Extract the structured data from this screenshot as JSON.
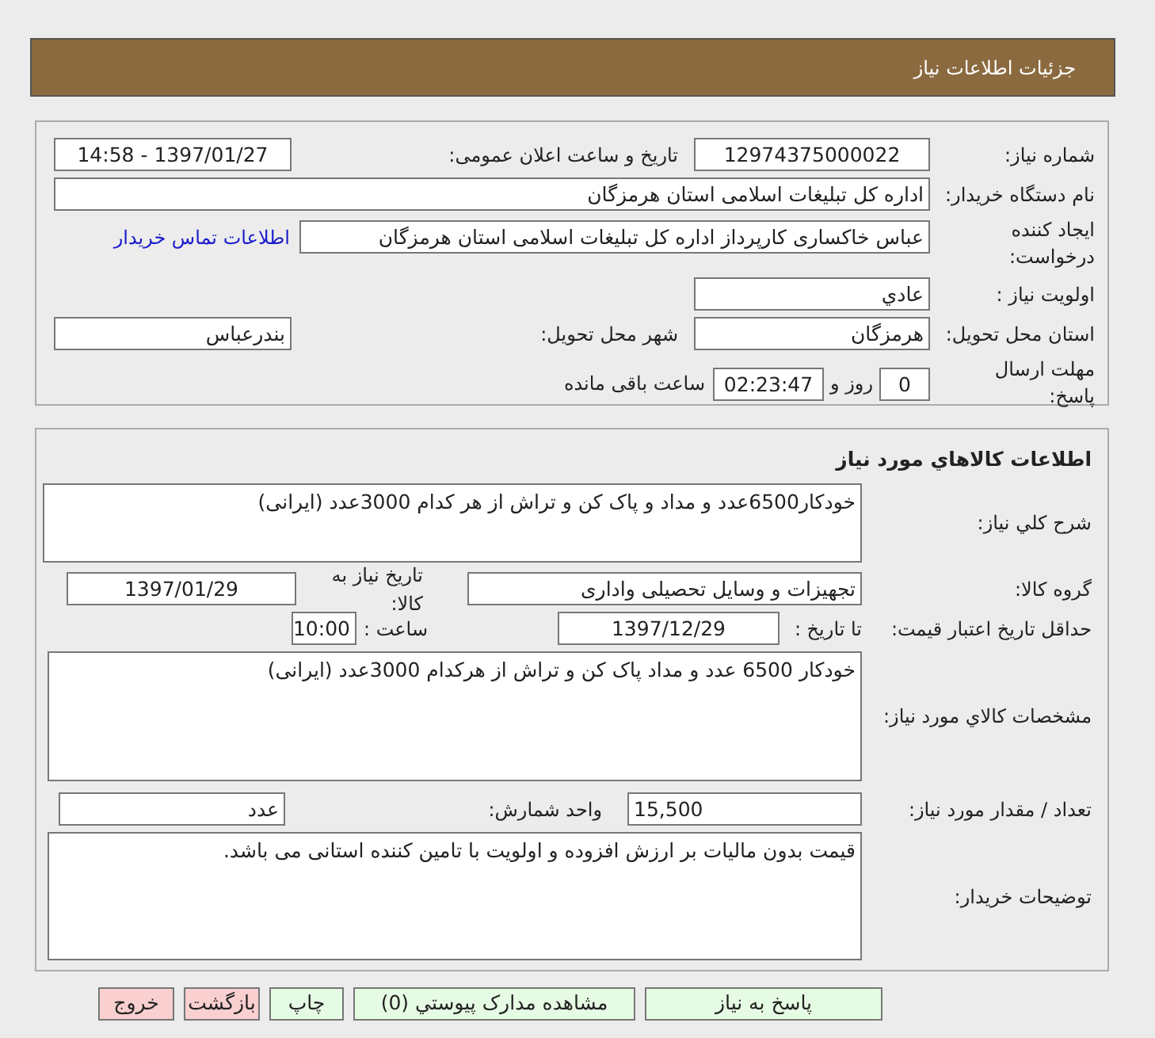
{
  "header": {
    "title": "جزئیات اطلاعات نیاز"
  },
  "need_info": {
    "need_number": {
      "label": "شماره نیاز:",
      "value": "12974375000022"
    },
    "announce_datetime": {
      "label": "تاریخ و ساعت اعلان عمومی:",
      "value": "1397/01/27 - 14:58"
    },
    "buyer_org": {
      "label": "نام دستگاه خریدار:",
      "value": "اداره کل تبلیغات اسلامی استان هرمزگان"
    },
    "requester": {
      "label": "ایجاد کننده درخواست:",
      "value": "عباس  خاکساری  کارپرداز اداره کل تبلیغات اسلامی استان هرمزگان"
    },
    "contact_link": "اطلاعات تماس خریدار",
    "priority": {
      "label": "اولویت نیاز :",
      "value": "عادي"
    },
    "delivery_province": {
      "label": "استان محل تحویل:",
      "value": "هرمزگان"
    },
    "delivery_city": {
      "label": "شهر محل تحویل:",
      "value": "بندرعباس"
    },
    "deadline": {
      "label": "مهلت ارسال پاسخ:",
      "days": "0",
      "days_unit": "روز و",
      "time": "02:23:47",
      "suffix": "ساعت باقی مانده"
    }
  },
  "goods": {
    "title": "اطلاعات کالاهاي مورد نياز",
    "general_description": {
      "label": "شرح کلي نياز:",
      "value": "خودکار6500عدد و مداد و پاک کن و تراش از هر کدام 3000عدد (ایرانی)"
    },
    "goods_group": {
      "label": "گروه کالا:",
      "value": "تجهیزات و وسایل تحصیلی واداری"
    },
    "need_date": {
      "label": "تاریخ نیاز به کالا:",
      "value": "1397/01/29"
    },
    "price_validity": {
      "label": "حداقل تاریخ اعتبار قیمت:",
      "date_label": "تا تاریخ :",
      "date": "1397/12/29",
      "time_label": "ساعت :",
      "time": "10:00"
    },
    "specifications": {
      "label": "مشخصات کالاي مورد نياز:",
      "value": "خودکار 6500 عدد و مداد پاک کن و تراش  از هرکدام 3000عدد (ایرانی)"
    },
    "quantity": {
      "label": "تعداد / مقدار مورد نیاز:",
      "value": "15,500"
    },
    "unit": {
      "label": "واحد شمارش:",
      "value": "عدد"
    },
    "buyer_notes": {
      "label": "توضیحات خریدار:",
      "value": "قیمت بدون مالیات بر ارزش افزوده و اولویت با تامین کننده استانی می باشد."
    }
  },
  "buttons": [
    {
      "label": "پاسخ به نیاز",
      "kind": "action"
    },
    {
      "label": "مشاهده مدارک پیوستي (0)",
      "kind": "action"
    },
    {
      "label": "چاپ",
      "kind": "action"
    },
    {
      "label": "بازگشت",
      "kind": "danger"
    },
    {
      "label": "خروج",
      "kind": "danger"
    }
  ]
}
